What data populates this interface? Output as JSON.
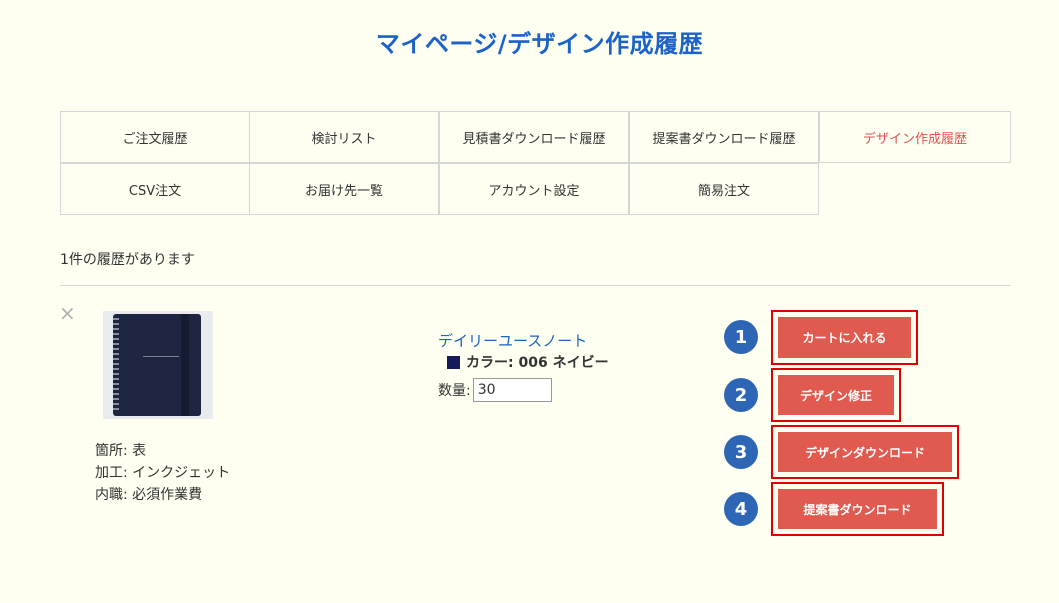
{
  "page": {
    "title": "マイページ/デザイン作成履歴"
  },
  "tabs": [
    {
      "label": "ご注文履歴",
      "active": false
    },
    {
      "label": "検討リスト",
      "active": false
    },
    {
      "label": "見積書ダウンロード履歴",
      "active": false
    },
    {
      "label": "提案書ダウンロード履歴",
      "active": false
    },
    {
      "label": "デザイン作成履歴",
      "active": true
    },
    {
      "label": "CSV注文",
      "active": false
    },
    {
      "label": "お届け先一覧",
      "active": false
    },
    {
      "label": "アカウント設定",
      "active": false
    },
    {
      "label": "簡易注文",
      "active": false
    }
  ],
  "history": {
    "count_text": "1件の履歴があります"
  },
  "item": {
    "remove_symbol": "×",
    "image": "notebook-product-image",
    "name": "デイリーユースノート",
    "color_label": "カラー: 006 ネイビー",
    "color_hex": "#161a5a",
    "quantity_label": "数量:",
    "quantity_value": "30",
    "meta": [
      "箇所: 表",
      "加工: インクジェット",
      "内職: 必須作業費"
    ]
  },
  "actions": [
    {
      "number": "1",
      "label": "カートに入れる"
    },
    {
      "number": "2",
      "label": "デザイン修正"
    },
    {
      "number": "3",
      "label": "デザインダウンロード"
    },
    {
      "number": "4",
      "label": "提案書ダウンロード"
    }
  ],
  "colors": {
    "accent_blue": "#1b62c9",
    "active_tab": "#e05050",
    "button_red": "#e05a4f",
    "highlight": "#e10000",
    "badge": "#2d66b4",
    "background": "#fefef1"
  }
}
